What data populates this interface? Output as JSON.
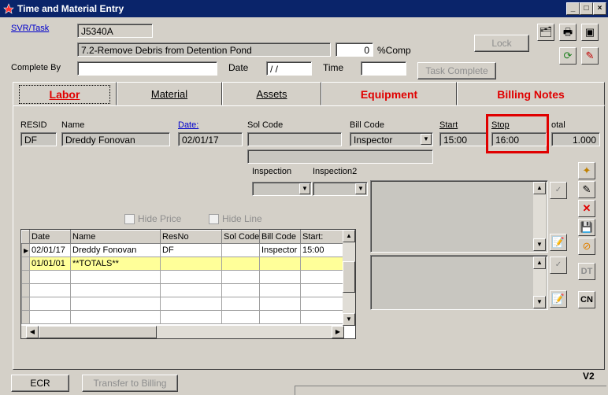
{
  "window": {
    "title": "Time and Material Entry"
  },
  "header": {
    "svr_task_label": "SVR/Task",
    "task_id": "J5340A",
    "task_desc": "7.2-Remove Debris from Detention Pond",
    "percent_value": "0",
    "percent_label": "%Comp",
    "complete_by_label": "Complete By",
    "complete_by_value": "",
    "date_label": "Date",
    "date_value": " / /",
    "time_label": "Time",
    "time_value": "",
    "lock_label": "Lock",
    "task_complete_label": "Task Complete"
  },
  "tabs": [
    {
      "label": "Labor"
    },
    {
      "label": "Material"
    },
    {
      "label": "Assets"
    },
    {
      "label": "Equipment"
    },
    {
      "label": "Billing Notes"
    }
  ],
  "labor": {
    "resid_label": "RESID",
    "resid_value": "DF",
    "name_label": "Name",
    "name_value": "Dreddy Fonovan",
    "date_label": "Date:",
    "date_value": "02/01/17",
    "solcode_label": "Sol Code",
    "solcode_value": "",
    "billcode_label": "Bill Code",
    "billcode_value": "Inspector",
    "start_label": "Start",
    "start_value": "15:00",
    "stop_label": "Stop",
    "stop_value": "16:00",
    "total_label": "otal",
    "total_value": "1.000",
    "inspection_label": "Inspection",
    "inspection2_label": "Inspection2",
    "hide_price_label": "Hide Price",
    "hide_line_label": "Hide Line"
  },
  "grid": {
    "columns": [
      "Date",
      "Name",
      "ResNo",
      "Sol Code",
      "Bill Code",
      "Start:"
    ],
    "rows": [
      [
        "02/01/17",
        "Dreddy Fonovan",
        "DF",
        "",
        "Inspector",
        "15:00"
      ],
      [
        "01/01/01",
        "**TOTALS**",
        "",
        "",
        "",
        ""
      ]
    ]
  },
  "side_buttons": {
    "dt_label": "DT",
    "cn_label": "CN"
  },
  "footer": {
    "ecr_label": "ECR",
    "transfer_label": "Transfer to Billing",
    "version": "V2"
  },
  "colors": {
    "highlight_border": "#e00000",
    "totals_row": "#ffff99",
    "tab_red": "#e00000",
    "titlebar": "#0a246a"
  }
}
